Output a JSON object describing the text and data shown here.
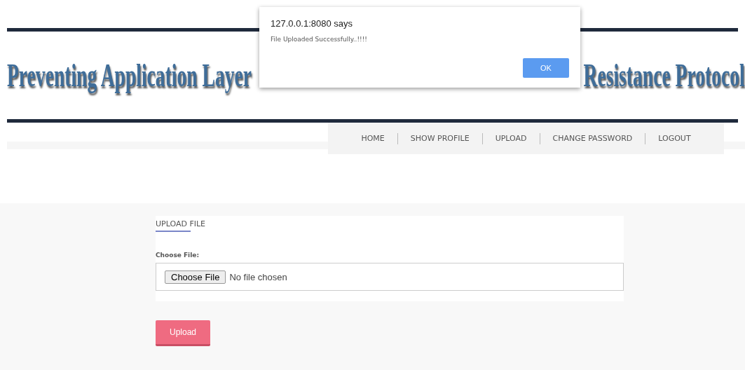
{
  "banner": {
    "title_left": "Preventing Application Layer",
    "title_right": "Resistance Protocol"
  },
  "nav": {
    "items": [
      {
        "label": "HOME"
      },
      {
        "label": "SHOW PROFILE"
      },
      {
        "label": "UPLOAD"
      },
      {
        "label": "CHANGE PASSWORD"
      },
      {
        "label": "LOGOUT"
      }
    ]
  },
  "form": {
    "heading": "UPLOAD FILE",
    "field_label": "Choose File:",
    "file_button": "Choose File",
    "file_status": "No file chosen",
    "submit": "Upload"
  },
  "dialog": {
    "origin": "127.0.0.1:8080 says",
    "message": "File Uploaded Successfully..!!!!",
    "button": "OK"
  }
}
